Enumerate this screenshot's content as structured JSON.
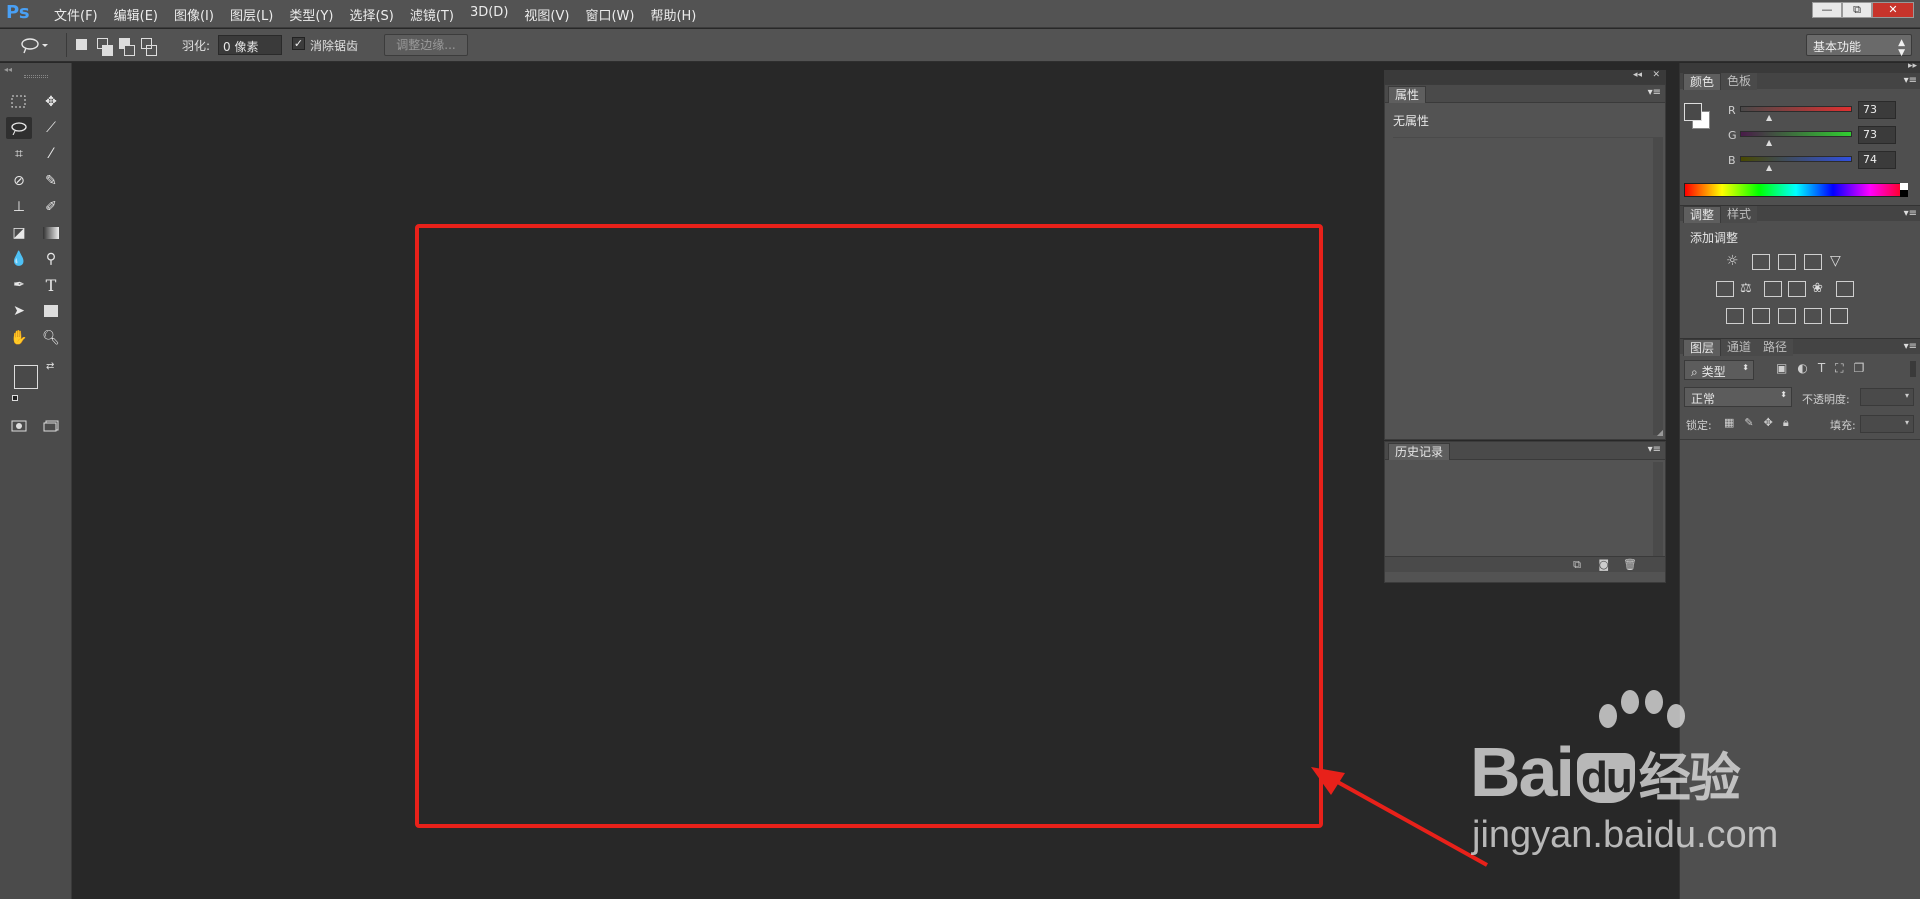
{
  "app": {
    "logo": "Ps"
  },
  "menu": [
    "文件(F)",
    "编辑(E)",
    "图像(I)",
    "图层(L)",
    "类型(Y)",
    "选择(S)",
    "滤镜(T)",
    "3D(D)",
    "视图(V)",
    "窗口(W)",
    "帮助(H)"
  ],
  "window_controls": {
    "minimize": "—",
    "restore": "⧉",
    "close": "✕"
  },
  "options": {
    "feather_label": "羽化:",
    "feather_value": "0 像素",
    "antialias_label": "消除锯齿",
    "antialias_checked": true,
    "refine_edge_button": "调整边缘...",
    "workspace": "基本功能"
  },
  "panels": {
    "properties": {
      "tab": "属性",
      "content": "无属性"
    },
    "history": {
      "tab": "历史记录"
    },
    "color": {
      "tabs": [
        "颜色",
        "色板"
      ],
      "channels": [
        {
          "label": "R",
          "value": "73",
          "color": "#c83232"
        },
        {
          "label": "G",
          "value": "73",
          "color": "#32b432"
        },
        {
          "label": "B",
          "value": "74",
          "color": "#3246c8"
        }
      ]
    },
    "adjustments": {
      "tabs": [
        "调整",
        "样式"
      ],
      "title": "添加调整"
    },
    "layers": {
      "tabs": [
        "图层",
        "通道",
        "路径"
      ],
      "filter": "类型",
      "blend_mode": "正常",
      "opacity_label": "不透明度:",
      "lock_label": "锁定:",
      "fill_label": "填充:"
    }
  },
  "watermark": {
    "brand": "Bai",
    "brand_du": "du",
    "brand_cn": "经验",
    "url": "jingyan.baidu.com"
  },
  "annotation": {
    "color": "#e8211a"
  }
}
